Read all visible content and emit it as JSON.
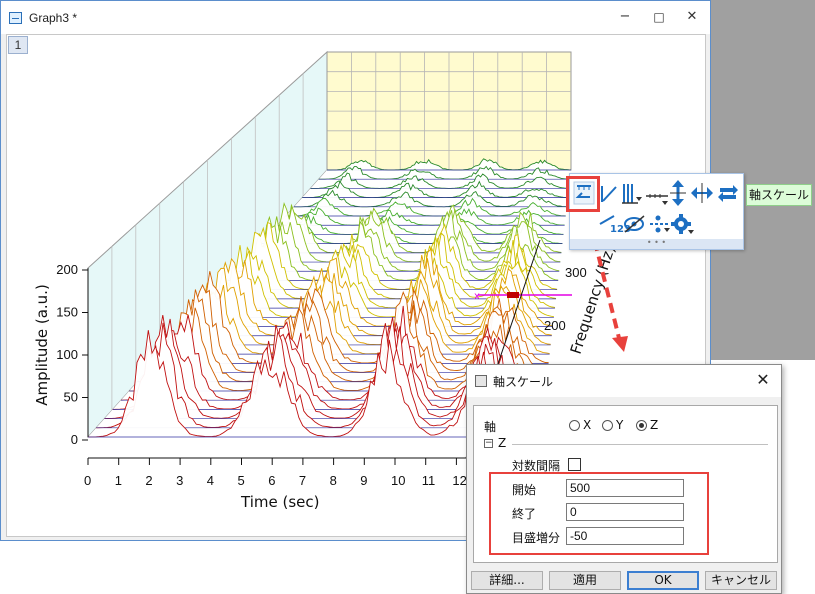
{
  "window": {
    "title": "Graph3 *",
    "minimize_glyph": "−",
    "maximize_glyph": "□",
    "close_glyph": "✕",
    "layer_tab": "1"
  },
  "plot": {
    "x_axis_title": "Time (sec)",
    "y_axis_title": "Amplitude (a.u.)",
    "z_axis_title": "Frequency (Hz)",
    "x_ticks": [
      "0",
      "1",
      "2",
      "3",
      "4",
      "5",
      "6",
      "7",
      "8",
      "9",
      "10",
      "11",
      "12"
    ],
    "y_ticks": [
      "0",
      "50",
      "100",
      "150",
      "200"
    ],
    "z_ticks": [
      "200",
      "300"
    ]
  },
  "mini_toolbar": {
    "icons": [
      "axis-scale-icon",
      "rescale-icon",
      "tick-direction-icon",
      "axis-break-icon",
      "expand-vertical-icon",
      "expand-horizontal-icon",
      "swap-axes-icon",
      "tick-labels-icon",
      "hide-axis-icon",
      "grid-lines-icon",
      "axis-settings-icon"
    ],
    "more_glyph": "• • •"
  },
  "tooltip": {
    "text": "軸スケール"
  },
  "dialog": {
    "title": "軸スケール",
    "close_glyph": "✕",
    "axis_label": "軸",
    "axis_options": [
      "X",
      "Y",
      "Z"
    ],
    "axis_selected": "Z",
    "section_label": "Z",
    "collapse_glyph": "−",
    "log_label": "対数間隔",
    "from_label": "開始",
    "from_value": "500",
    "to_label": "終了",
    "to_value": "0",
    "increment_label": "目盛増分",
    "increment_value": "-50",
    "buttons": {
      "detail": "詳細...",
      "apply": "適用",
      "ok": "OK",
      "cancel": "キャンセル"
    }
  },
  "colors": {
    "highlight": "#e8413c",
    "back_wall": "#fffbcf",
    "side_wall": "#e6f8f8",
    "tooltip_bg": "#dcfcd8",
    "accent": "#3c7fd1"
  }
}
